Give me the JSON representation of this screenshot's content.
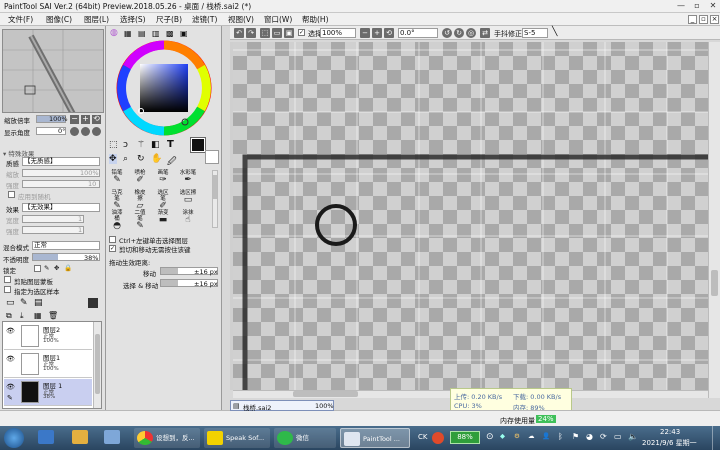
{
  "window": {
    "title": "PaintTool SAI Ver.2 (64bit) Preview.2018.05.26 - 桌面 / 栈桥.sai2 (*)"
  },
  "menu": {
    "items": [
      "文件(F)",
      "图像(C)",
      "图层(L)",
      "选择(S)",
      "尺子(B)",
      "滤镜(T)",
      "视图(V)",
      "窗口(W)",
      "帮助(H)"
    ]
  },
  "navigator": {
    "zoom_label": "缩放倍率",
    "zoom_value": "100%",
    "angle_label": "显示角度",
    "angle_value": "0°"
  },
  "effects": {
    "header": "▾ 特殊效果",
    "texture_label": "质感",
    "texture_value": "【无质感】",
    "scale_label": "缩放",
    "scale_value": "100%",
    "strength_label": "强度",
    "strength_value": "10",
    "emboss_label": "应用到随机",
    "effect_label": "效果",
    "effect_value": "【无效果】",
    "width_label": "宽度",
    "width_value": "1",
    "strength2_label": "强度",
    "strength2_value": "1"
  },
  "layer_props": {
    "blend_label": "混合模式",
    "blend_value": "正常",
    "opacity_label": "不透明度",
    "opacity_value": "38%",
    "opacity_fraction": 0.38,
    "lock_label": "锁定",
    "clip_label": "剪贴图层蒙板",
    "ref_label": "指定为选区样本"
  },
  "layers": [
    {
      "name": "图层2",
      "mode": "正常",
      "opacity": "100%",
      "dark": false,
      "selected": false
    },
    {
      "name": "图层1",
      "mode": "正常",
      "opacity": "100%",
      "dark": false,
      "selected": false
    },
    {
      "name": "图层 1",
      "mode": "正常",
      "opacity": "38%",
      "dark": true,
      "selected": true
    }
  ],
  "tools": {
    "brush_tools": [
      [
        "铅笔",
        "喷枪",
        "画笔",
        "水彩笔"
      ],
      [
        "马克笔",
        "橡皮擦",
        "选区笔",
        "选区擦"
      ],
      [
        "油漆桶",
        "二值笔",
        "渐变",
        "涂抹"
      ]
    ],
    "ctrl_select_label": "Ctrl+左键单击选择图层",
    "switch_label": "剪切和移动无需按住该键",
    "drag_label": "拖动生效距离:",
    "move_label": "移动",
    "move_value": "±16 px",
    "select_move_label": "选择 & 移动",
    "select_move_value": "±16 px"
  },
  "canvas_toolbar": {
    "select_label": "选择",
    "zoom_value": "100%",
    "angle_value": "0.0°",
    "hand_label": "手抖修正",
    "stabilizer_value": "S-5"
  },
  "file_tab": {
    "name": "栈桥.sai2",
    "zoom": "100%"
  },
  "status": {
    "memory_label": "内存使用量",
    "memory_value": "24%"
  },
  "perf": {
    "upload": "上传: 0.20 KB/s",
    "download": "下载: 0.00 KB/s",
    "cpu": "CPU: 3%",
    "mem": "内存: 89%"
  },
  "taskbar": {
    "items": [
      "设想到，反...",
      "Speak Sof...",
      "微信",
      "PaintTool ..."
    ],
    "battery": "88%",
    "time": "22:43",
    "date": "2021/9/6 星期一"
  },
  "colors": {
    "accent": "#3c7de0",
    "selection": "#c9cff0",
    "taskbar": "#2f4b66"
  }
}
